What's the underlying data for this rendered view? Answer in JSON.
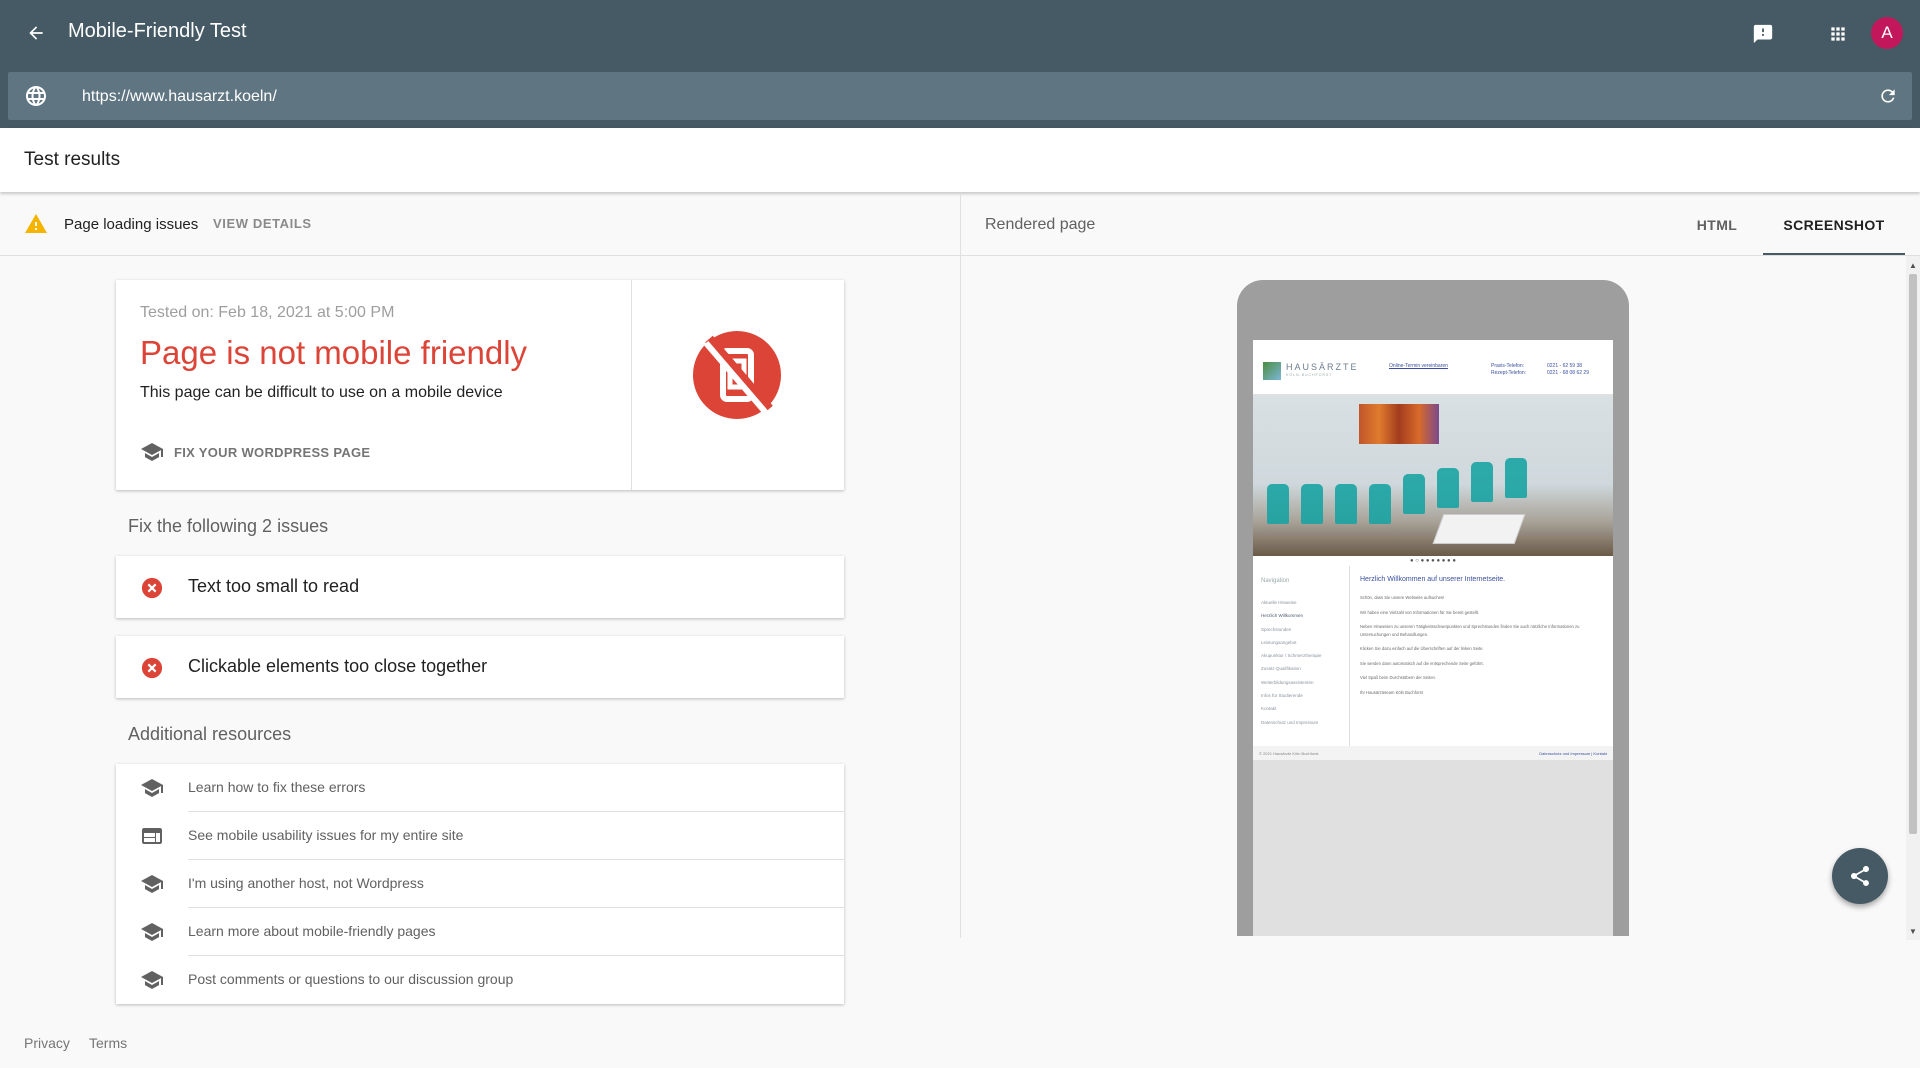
{
  "appbar": {
    "title": "Mobile-Friendly Test",
    "avatar_letter": "A"
  },
  "url": {
    "value": "https://www.hausarzt.koeln/"
  },
  "results": {
    "title": "Test results",
    "issues_bar": {
      "label": "Page loading issues",
      "action": "VIEW DETAILS"
    },
    "card": {
      "tested_on": "Tested on: Feb 18, 2021 at 5:00 PM",
      "verdict": "Page is not mobile friendly",
      "subtitle": "This page can be difficult to use on a mobile device",
      "fix_link": "FIX YOUR WORDPRESS PAGE",
      "verdict_color": "#db4437"
    },
    "fix_heading": "Fix the following 2 issues",
    "issues": [
      "Text too small to read",
      "Clickable elements too close together"
    ],
    "additional_heading": "Additional resources",
    "resources": [
      {
        "icon": "school-icon",
        "label": "Learn how to fix these errors"
      },
      {
        "icon": "web-icon",
        "label": "See mobile usability issues for my entire site"
      },
      {
        "icon": "school-icon",
        "label": "I'm using another host, not Wordpress"
      },
      {
        "icon": "school-icon",
        "label": "Learn more about mobile-friendly pages"
      },
      {
        "icon": "school-icon",
        "label": "Post comments or questions to our discussion group"
      }
    ]
  },
  "footer": {
    "privacy": "Privacy",
    "terms": "Terms"
  },
  "rendered": {
    "label": "Rendered page",
    "tabs": [
      "HTML",
      "SCREENSHOT"
    ],
    "active_tab": "SCREENSHOT"
  },
  "screenshot_site": {
    "logo": "HAUSÄRZTE",
    "logo_sub": "KÖLN-BUCHFORST",
    "appointment_link": "Online-Termin vereinbaren",
    "phone_labels": "Praxis-Telefon:\nRezept-Telefon:",
    "phone_numbers": "0221 - 62 59 38\n0221 - 68 08 62 29",
    "nav_title": "Navigation",
    "nav_items": [
      "Aktuelle Hinweise",
      "Herzlich Willkommen",
      "Sprechstunden",
      "Leistungsangebot",
      "Akupunktur / Schmerztherapie",
      "Zusatz-Qualifikation",
      "Weiterbildungsassistenten",
      "Infos für Studierende",
      "Kontakt",
      "Datenschutz und Impressum"
    ],
    "content_title": "Herzlich Willkommen auf unserer Internetseite.",
    "content_paragraphs": [
      "Schön, dass Sie unsere Webseite aufsuchen!",
      "Wir haben eine Vielzahl von Informationen für Sie bereit gestellt.",
      "Neben Hinweisen zu unseren Tätigkeitsschwerpunkten und Sprechstunden finden Sie auch nützliche Informationen zu Untersuchungen und Behandlungen.",
      "Klicken Sie dazu einfach auf die Überschriften auf der linken Seite.",
      "Sie werden dann automatisch auf die entsprechende Seite geführt.",
      "Viel Spaß beim Durchstöbern der Seiten.",
      "Ihr Hausärzteteam Köln Buchforst"
    ],
    "footer_left": "© 2021 Hausärzte Köln Buchforst",
    "footer_right": "Datenschutz und Impressum  |  Kontakt"
  },
  "colors": {
    "appbar": "#455a64",
    "urlbar": "#5f7581",
    "error": "#db4437",
    "warning": "#f4b400"
  }
}
